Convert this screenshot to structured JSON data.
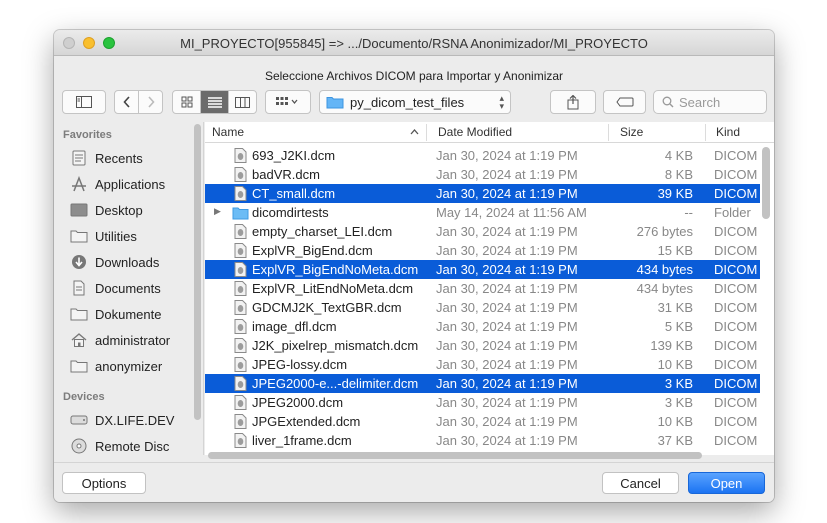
{
  "window": {
    "title": "MI_PROYECTO[955845] => .../Documento/RSNA Anonimizador/MI_PROYECTO",
    "prompt": "Seleccione Archivos DICOM para Importar y Anonimizar"
  },
  "toolbar": {
    "location": "py_dicom_test_files",
    "search_placeholder": "Search"
  },
  "sidebar": {
    "favorites_header": "Favorites",
    "favorites": [
      {
        "label": "Recents",
        "icon": "recents-icon"
      },
      {
        "label": "Applications",
        "icon": "applications-icon"
      },
      {
        "label": "Desktop",
        "icon": "desktop-icon"
      },
      {
        "label": "Utilities",
        "icon": "folder-icon"
      },
      {
        "label": "Downloads",
        "icon": "downloads-icon"
      },
      {
        "label": "Documents",
        "icon": "documents-icon"
      },
      {
        "label": "Dokumente",
        "icon": "folder-icon"
      },
      {
        "label": "administrator",
        "icon": "home-icon"
      },
      {
        "label": "anonymizer",
        "icon": "folder-icon"
      }
    ],
    "devices_header": "Devices",
    "devices": [
      {
        "label": "DX.LIFE.DEV",
        "icon": "drive-icon"
      },
      {
        "label": "Remote Disc",
        "icon": "disc-icon"
      }
    ]
  },
  "columns": {
    "name": "Name",
    "date": "Date Modified",
    "size": "Size",
    "kind": "Kind"
  },
  "files": [
    {
      "name": "693_J2KI.dcm",
      "date": "Jan 30, 2024 at 1:19 PM",
      "size": "4 KB",
      "kind": "DICOM",
      "selected": false
    },
    {
      "name": "badVR.dcm",
      "date": "Jan 30, 2024 at 1:19 PM",
      "size": "8 KB",
      "kind": "DICOM",
      "selected": false
    },
    {
      "name": "CT_small.dcm",
      "date": "Jan 30, 2024 at 1:19 PM",
      "size": "39 KB",
      "kind": "DICOM",
      "selected": true
    },
    {
      "name": "dicomdirtests",
      "date": "May 14, 2024 at 11:56 AM",
      "size": "--",
      "kind": "Folder",
      "selected": false,
      "folder": true
    },
    {
      "name": "empty_charset_LEI.dcm",
      "date": "Jan 30, 2024 at 1:19 PM",
      "size": "276 bytes",
      "kind": "DICOM",
      "selected": false
    },
    {
      "name": "ExplVR_BigEnd.dcm",
      "date": "Jan 30, 2024 at 1:19 PM",
      "size": "15 KB",
      "kind": "DICOM",
      "selected": false
    },
    {
      "name": "ExplVR_BigEndNoMeta.dcm",
      "date": "Jan 30, 2024 at 1:19 PM",
      "size": "434 bytes",
      "kind": "DICOM",
      "selected": true
    },
    {
      "name": "ExplVR_LitEndNoMeta.dcm",
      "date": "Jan 30, 2024 at 1:19 PM",
      "size": "434 bytes",
      "kind": "DICOM",
      "selected": false
    },
    {
      "name": "GDCMJ2K_TextGBR.dcm",
      "date": "Jan 30, 2024 at 1:19 PM",
      "size": "31 KB",
      "kind": "DICOM",
      "selected": false
    },
    {
      "name": "image_dfl.dcm",
      "date": "Jan 30, 2024 at 1:19 PM",
      "size": "5 KB",
      "kind": "DICOM",
      "selected": false
    },
    {
      "name": "J2K_pixelrep_mismatch.dcm",
      "date": "Jan 30, 2024 at 1:19 PM",
      "size": "139 KB",
      "kind": "DICOM",
      "selected": false
    },
    {
      "name": "JPEG-lossy.dcm",
      "date": "Jan 30, 2024 at 1:19 PM",
      "size": "10 KB",
      "kind": "DICOM",
      "selected": false
    },
    {
      "name": "JPEG2000-e...-delimiter.dcm",
      "date": "Jan 30, 2024 at 1:19 PM",
      "size": "3 KB",
      "kind": "DICOM",
      "selected": true
    },
    {
      "name": "JPEG2000.dcm",
      "date": "Jan 30, 2024 at 1:19 PM",
      "size": "3 KB",
      "kind": "DICOM",
      "selected": false
    },
    {
      "name": "JPGExtended.dcm",
      "date": "Jan 30, 2024 at 1:19 PM",
      "size": "10 KB",
      "kind": "DICOM",
      "selected": false
    },
    {
      "name": "liver_1frame.dcm",
      "date": "Jan 30, 2024 at 1:19 PM",
      "size": "37 KB",
      "kind": "DICOM",
      "selected": false
    }
  ],
  "buttons": {
    "options": "Options",
    "cancel": "Cancel",
    "open": "Open"
  },
  "colors": {
    "selection": "#0a5cd8",
    "primary": "#1b73f2"
  }
}
